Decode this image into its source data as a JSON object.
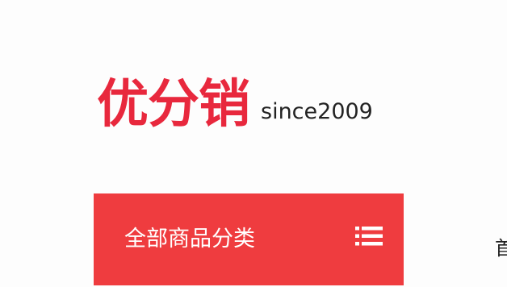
{
  "logo": {
    "brand": "优分销",
    "tagline": "since2009",
    "brand_color": "#e8283d"
  },
  "category_menu": {
    "label": "全部商品分类",
    "icon": "list-icon",
    "background_color": "#ef3c3f"
  },
  "nav": {
    "first_item_partial": "首"
  }
}
